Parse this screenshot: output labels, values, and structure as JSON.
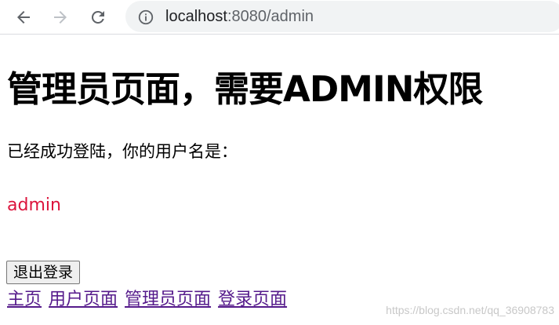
{
  "browser": {
    "back_icon": "arrow-left-icon",
    "forward_icon": "arrow-right-icon",
    "reload_icon": "reload-icon",
    "info_icon": "info-icon",
    "url_host": "localhost",
    "url_rest": ":8080/admin"
  },
  "page": {
    "heading": "管理员页面，需要ADMIN权限",
    "status_text": "已经成功登陆，你的用户名是：",
    "username": "admin",
    "username_color": "#dc143c",
    "logout_label": "退出登录",
    "links": [
      {
        "label": "主页"
      },
      {
        "label": "用户页面"
      },
      {
        "label": "管理员页面"
      },
      {
        "label": "登录页面"
      }
    ],
    "link_color": "#551a8b"
  },
  "watermark": "https://blog.csdn.net/qq_36908783"
}
